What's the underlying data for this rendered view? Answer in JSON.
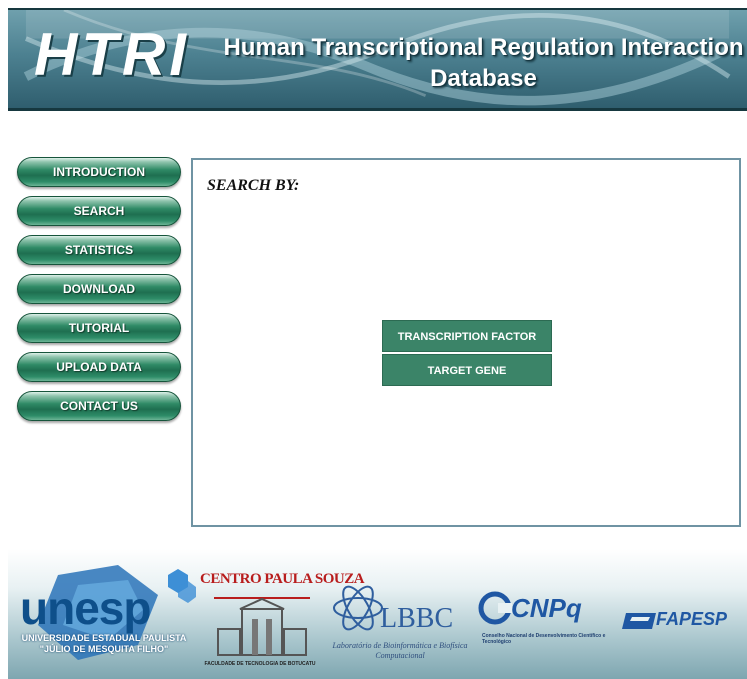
{
  "header": {
    "logo_text": "HTRI",
    "title": "Human Transcriptional Regulation Interaction Database"
  },
  "nav": {
    "items": [
      {
        "label": "INTRODUCTION"
      },
      {
        "label": "SEARCH"
      },
      {
        "label": "STATISTICS"
      },
      {
        "label": "DOWNLOAD"
      },
      {
        "label": "TUTORIAL"
      },
      {
        "label": "UPLOAD DATA"
      },
      {
        "label": "CONTACT US"
      }
    ]
  },
  "main": {
    "heading": "SEARCH BY:",
    "options": [
      {
        "label": "TRANSCRIPTION FACTOR"
      },
      {
        "label": "TARGET GENE"
      }
    ]
  },
  "footer": {
    "unesp": {
      "name": "unesp",
      "line1": "UNIVERSIDADE ESTADUAL PAULISTA",
      "line2": "\"JÚLIO DE MESQUITA FILHO\""
    },
    "cps": {
      "name": "CENTRO PAULA SOUZA",
      "subtitle": "FACULDADE DE TECNOLOGIA DE BOTUCATU"
    },
    "lbbc": {
      "name": "LBBC",
      "subtitle": "Laboratório de Bioinformática e Biofísica Computacional"
    },
    "cnpq": {
      "name": "CNPq",
      "subtitle": "Conselho Nacional de Desenvolvimento Científico e Tecnológico"
    },
    "fapesp": {
      "name": "FAPESP"
    }
  },
  "colors": {
    "nav_button": "#2f8a66",
    "option_button": "#3b8468",
    "panel_border": "#6f93a3",
    "banner": "#4d8191"
  }
}
